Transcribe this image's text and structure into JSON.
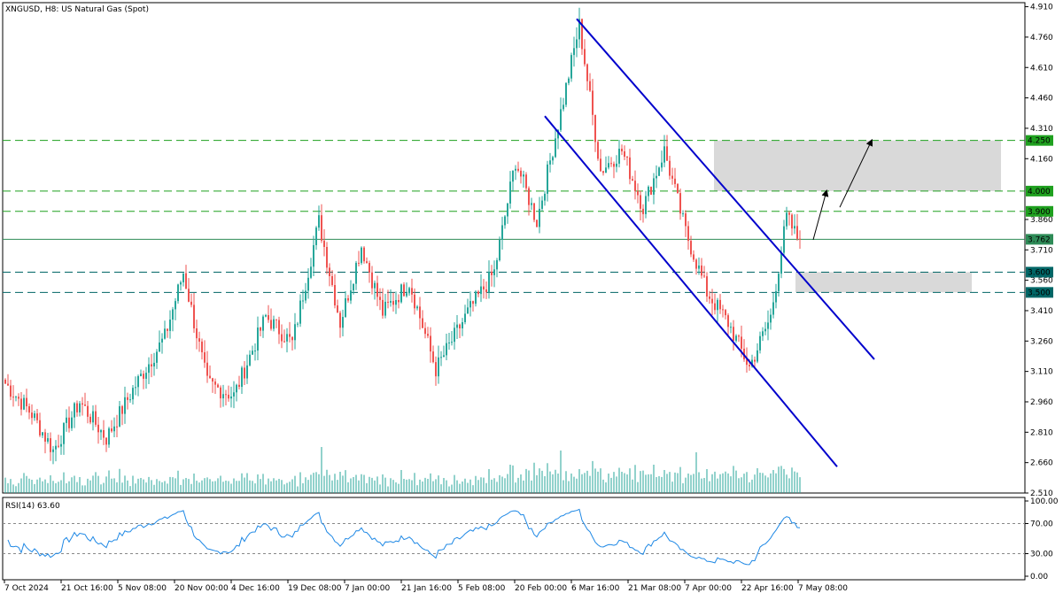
{
  "title": "XNGUSD, H8:  US Natural Gas (Spot)",
  "colors": {
    "bull": "#26a69a",
    "bear": "#ef5350",
    "grid": "#e6e6e6",
    "channel": "#0000cc",
    "level_green": "#1fa01f",
    "level_dark": "#006666",
    "current_line": "#2e8b57",
    "zone": "#d9d9d9",
    "volume": "#26a69a",
    "rsi": "#1e88e5"
  },
  "price_axis_ticks": [
    "4.910",
    "4.760",
    "4.610",
    "4.460",
    "4.310",
    "4.160",
    "3.860",
    "3.710",
    "3.560",
    "3.410",
    "3.260",
    "3.110",
    "2.960",
    "2.810",
    "2.660",
    "2.510"
  ],
  "price_labels": [
    {
      "value": "4.250",
      "color": "#1fa01f"
    },
    {
      "value": "4.000",
      "color": "#1fa01f"
    },
    {
      "value": "3.900",
      "color": "#1fa01f"
    },
    {
      "value": "3.762",
      "color": "#2e8b57"
    },
    {
      "value": "3.600",
      "color": "#006666"
    },
    {
      "value": "3.500",
      "color": "#006666"
    }
  ],
  "rsi": {
    "label": "RSI(14) 63.60",
    "ticks": [
      "100.00",
      "70.00",
      "30.00",
      "0.00"
    ]
  },
  "x_axis_labels": [
    "7 Oct 2024",
    "21 Oct 16:00",
    "5 Nov 08:00",
    "20 Nov 00:00",
    "4 Dec 16:00",
    "19 Dec 08:00",
    "7 Jan 00:00",
    "21 Jan 16:00",
    "5 Feb 08:00",
    "20 Feb 00:00",
    "6 Mar 16:00",
    "21 Mar 08:00",
    "7 Apr 00:00",
    "22 Apr 16:00",
    "7 May 08:00"
  ],
  "chart_data": {
    "type": "candlestick",
    "symbol": "XNGUSD",
    "timeframe": "H8",
    "ylim": [
      2.51,
      4.93
    ],
    "last_price": 3.762,
    "anchors": [
      {
        "i": 0,
        "v": 3.05
      },
      {
        "i": 10,
        "v": 2.9
      },
      {
        "i": 18,
        "v": 2.72
      },
      {
        "i": 28,
        "v": 2.96
      },
      {
        "i": 38,
        "v": 2.78
      },
      {
        "i": 48,
        "v": 3.02
      },
      {
        "i": 60,
        "v": 3.28
      },
      {
        "i": 67,
        "v": 3.6
      },
      {
        "i": 76,
        "v": 3.05
      },
      {
        "i": 86,
        "v": 2.99
      },
      {
        "i": 98,
        "v": 3.38
      },
      {
        "i": 108,
        "v": 3.25
      },
      {
        "i": 118,
        "v": 3.85
      },
      {
        "i": 126,
        "v": 3.35
      },
      {
        "i": 134,
        "v": 3.73
      },
      {
        "i": 142,
        "v": 3.4
      },
      {
        "i": 152,
        "v": 3.55
      },
      {
        "i": 162,
        "v": 3.12
      },
      {
        "i": 174,
        "v": 3.4
      },
      {
        "i": 184,
        "v": 3.6
      },
      {
        "i": 192,
        "v": 4.15
      },
      {
        "i": 200,
        "v": 3.85
      },
      {
        "i": 210,
        "v": 4.45
      },
      {
        "i": 216,
        "v": 4.82
      },
      {
        "i": 224,
        "v": 4.1
      },
      {
        "i": 232,
        "v": 4.2
      },
      {
        "i": 240,
        "v": 3.92
      },
      {
        "i": 248,
        "v": 4.2
      },
      {
        "i": 256,
        "v": 3.8
      },
      {
        "i": 264,
        "v": 3.5
      },
      {
        "i": 272,
        "v": 3.35
      },
      {
        "i": 280,
        "v": 3.13
      },
      {
        "i": 288,
        "v": 3.38
      },
      {
        "i": 294,
        "v": 3.87
      },
      {
        "i": 298,
        "v": 3.77
      }
    ],
    "levels": [
      4.25,
      4.0,
      3.9,
      3.6,
      3.5
    ],
    "zones": [
      {
        "from": 4.0,
        "to": 4.25
      },
      {
        "from": 3.5,
        "to": 3.6
      }
    ],
    "channel": {
      "upper": [
        {
          "i": 215,
          "v": 4.85
        },
        {
          "i": 327,
          "v": 3.17
        }
      ],
      "lower": [
        {
          "i": 203,
          "v": 4.37
        },
        {
          "i": 313,
          "v": 2.64
        }
      ]
    },
    "arrows": [
      {
        "from": {
          "i": 304,
          "v": 3.76
        },
        "to": {
          "i": 309,
          "v": 4.0
        }
      },
      {
        "from": {
          "i": 314,
          "v": 3.92
        },
        "to": {
          "i": 326,
          "v": 4.25
        }
      }
    ]
  }
}
